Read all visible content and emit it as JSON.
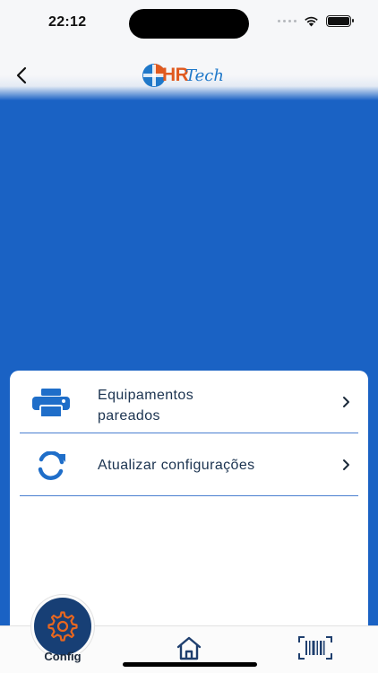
{
  "status_bar": {
    "time": "22:12"
  },
  "header": {
    "logo": {
      "part1": "HR",
      "part2": "Tech"
    }
  },
  "menu": {
    "items": [
      {
        "label": "Equipamentos pareados",
        "icon": "printer-icon"
      },
      {
        "label": "Atualizar configurações",
        "icon": "refresh-icon"
      }
    ]
  },
  "tabbar": {
    "tabs": [
      {
        "label": "Config",
        "icon": "gear-icon",
        "active": true
      },
      {
        "label": "",
        "icon": "home-icon"
      },
      {
        "label": "",
        "icon": "barcode-scanner-icon"
      }
    ]
  },
  "colors": {
    "primary_blue": "#1a62c4",
    "dark_navy": "#173f75",
    "accent_orange": "#e05a1f",
    "text_dark": "#1b3350"
  }
}
